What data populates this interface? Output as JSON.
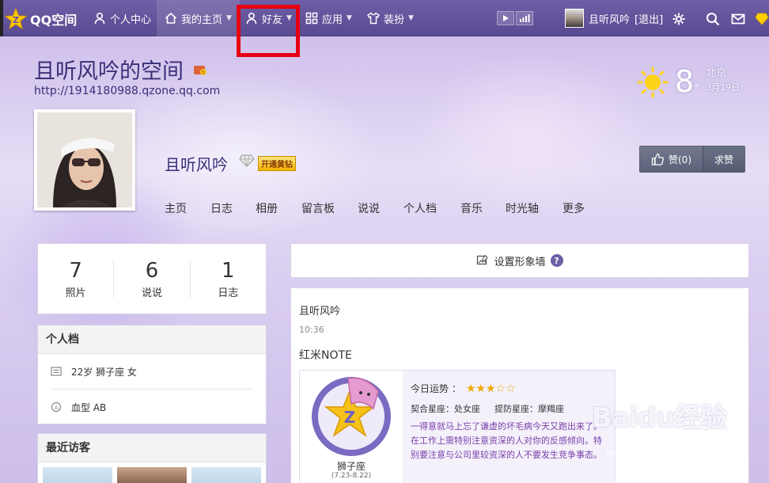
{
  "nav": {
    "logo_text": "QQ空间",
    "items": [
      {
        "label": "个人中心"
      },
      {
        "label": "我的主页"
      },
      {
        "label": "好友"
      },
      {
        "label": "应用"
      },
      {
        "label": "装扮"
      }
    ],
    "user_name": "且听风吟",
    "logout_label": "[退出]"
  },
  "header": {
    "space_title": "且听风吟的空间",
    "space_url": "http://1914180988.qzone.qq.com",
    "weather": {
      "temp": "8",
      "degree": "°",
      "city": "北京",
      "date": "3月19日"
    }
  },
  "profile": {
    "owner_name": "且听风吟",
    "vip_label": "开通黄钻",
    "like_label": "赞(0)",
    "beg_label": "求赞"
  },
  "subnav": [
    "主页",
    "日志",
    "相册",
    "留言板",
    "说说",
    "个人档",
    "音乐",
    "时光轴",
    "更多"
  ],
  "stats": [
    {
      "num": "7",
      "label": "照片"
    },
    {
      "num": "6",
      "label": "说说"
    },
    {
      "num": "1",
      "label": "日志"
    }
  ],
  "personal": {
    "title": "个人档",
    "info": "22岁  狮子座  女",
    "blood": "血型  AB"
  },
  "visitors": {
    "title": "最近访客"
  },
  "wall": {
    "label": "设置形象墙"
  },
  "feed": {
    "author": "且听风吟",
    "time": "10:36",
    "text": "红米NOTE",
    "horoscope": {
      "sign": "狮子座",
      "range": "(7.23-8.22)",
      "luck_label": "今日运势 ：",
      "stars": 3,
      "match": "契合星座：处女座",
      "guard": "提防星座：摩羯座",
      "fortune": "一得意就马上忘了谦虚的坏毛病今天又跑出来了。在工作上需特别注意资深的人对你的反感倾向。特别要注意与公司里较资深的人不要发生竞争事态。"
    }
  },
  "watermark": {
    "main": "Baidu经验",
    "sub": "jingyan.baidu.com"
  },
  "colors": {
    "nav_bg": "#5a4a92",
    "title": "#3a2f78",
    "highlight": "#e60012",
    "star": "#f0a800"
  }
}
